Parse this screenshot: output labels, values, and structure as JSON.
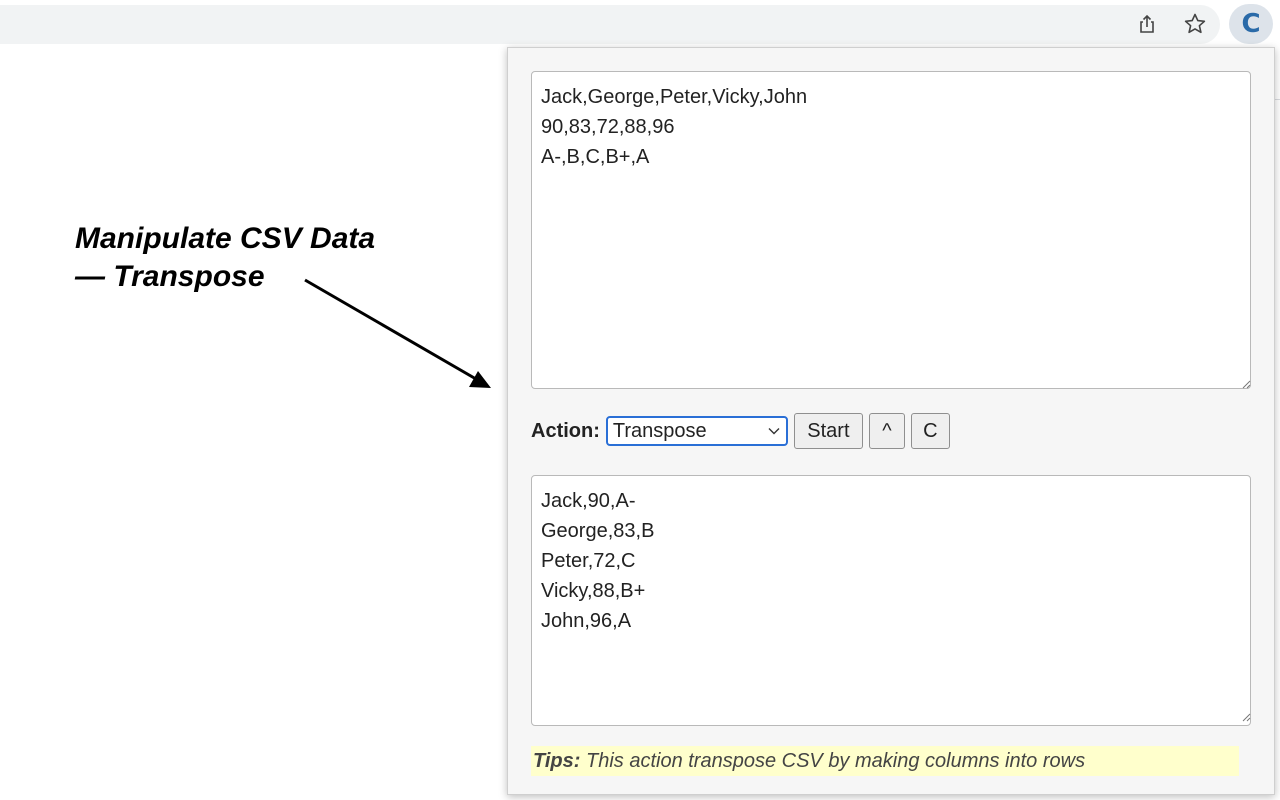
{
  "annotation": {
    "line1": "Manipulate CSV Data",
    "line2": "— Transpose"
  },
  "toolbar": {
    "extension_letter": "C"
  },
  "popup": {
    "input_text": "Jack,George,Peter,Vicky,John\n90,83,72,88,96\nA-,B,C,B+,A",
    "action_label": "Action:",
    "action_selected": "Transpose",
    "start_label": "Start",
    "up_label": "^",
    "clear_label": "C",
    "output_text": "Jack,90,A-\nGeorge,83,B\nPeter,72,C\nVicky,88,B+\nJohn,96,A",
    "tips_label": "Tips:",
    "tips_text": " This action transpose CSV by making columns into rows"
  },
  "colors": {
    "select_border": "#2a6fd6",
    "tips_background": "#ffffcc",
    "extension_icon": "#2a6aa8"
  },
  "icons": [
    "share-icon",
    "star-icon",
    "extension-icon",
    "chevron-down-icon",
    "resize-grip-icon"
  ]
}
